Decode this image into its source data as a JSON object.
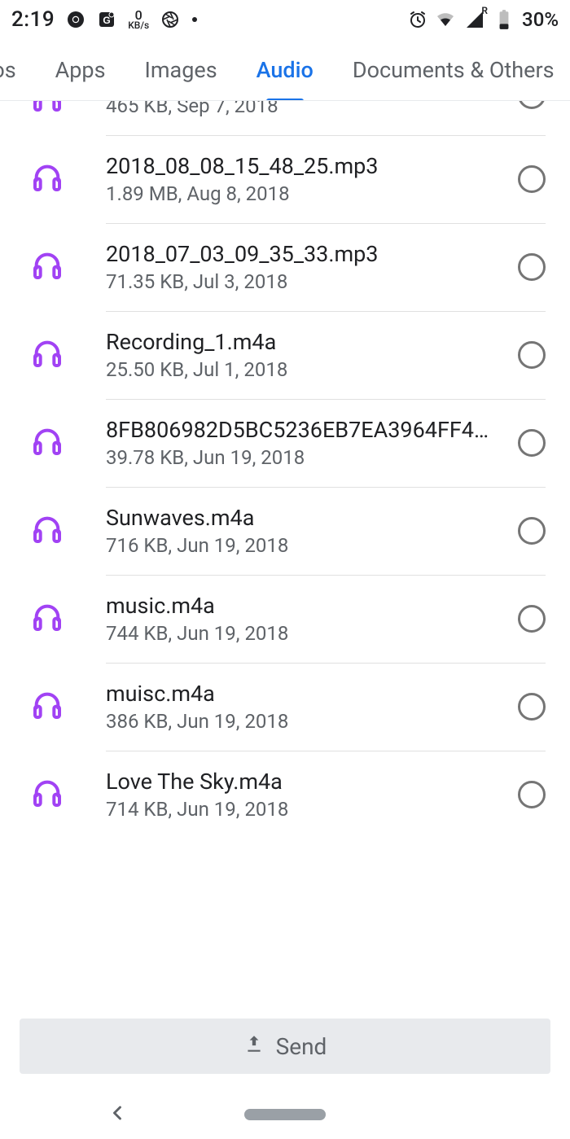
{
  "status": {
    "time": "2:19",
    "kb_val": "0",
    "kb_unit": "KB/s",
    "signal_letter": "R",
    "battery": "30%"
  },
  "tabs": {
    "cut": "eos",
    "apps": "Apps",
    "images": "Images",
    "audio": "Audio",
    "docs": "Documents & Others"
  },
  "files": [
    {
      "name": "",
      "meta": "465 KB, Sep 7, 2018"
    },
    {
      "name": "2018_08_08_15_48_25.mp3",
      "meta": "1.89 MB, Aug 8, 2018"
    },
    {
      "name": "2018_07_03_09_35_33.mp3",
      "meta": "71.35 KB, Jul 3, 2018"
    },
    {
      "name": "Recording_1.m4a",
      "meta": "25.50 KB, Jul 1, 2018"
    },
    {
      "name": "8FB806982D5BC5236EB7EA3964FF4…",
      "meta": "39.78 KB, Jun 19, 2018"
    },
    {
      "name": "Sunwaves.m4a",
      "meta": "716 KB, Jun 19, 2018"
    },
    {
      "name": "music.m4a",
      "meta": "744 KB, Jun 19, 2018"
    },
    {
      "name": "muisc.m4a",
      "meta": "386 KB, Jun 19, 2018"
    },
    {
      "name": "Love The Sky.m4a",
      "meta": "714 KB, Jun 19, 2018"
    }
  ],
  "send_label": "Send"
}
